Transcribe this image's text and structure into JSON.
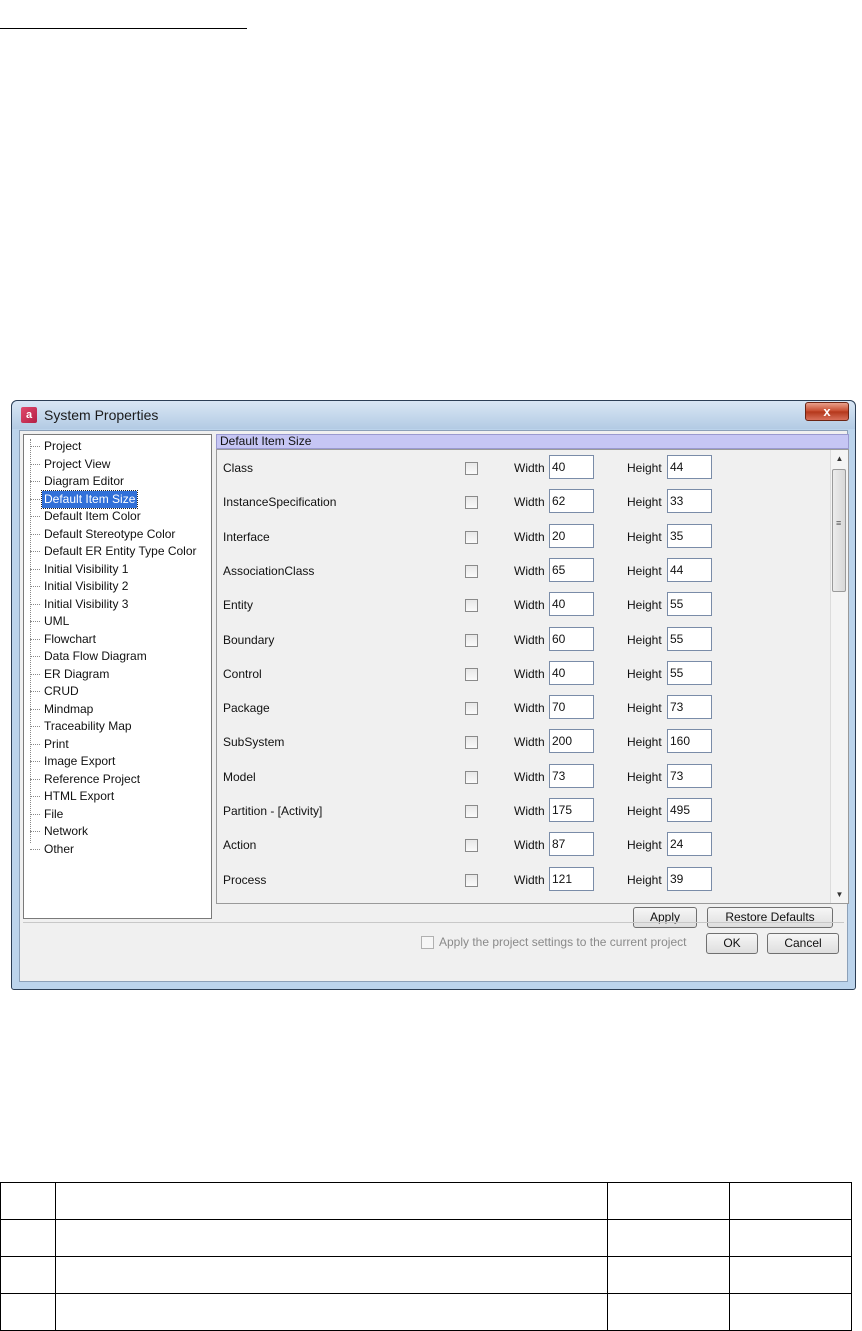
{
  "window": {
    "title": "System Properties",
    "app_icon_label": "a",
    "close_glyph": "x"
  },
  "tree": {
    "items": [
      "Project",
      "Project View",
      "Diagram Editor",
      "Default Item Size",
      "Default Item Color",
      "Default Stereotype Color",
      "Default ER Entity Type Color",
      "Initial Visibility 1",
      "Initial Visibility 2",
      "Initial Visibility 3",
      "UML",
      "Flowchart",
      "Data Flow Diagram",
      "ER Diagram",
      "CRUD",
      "Mindmap",
      "Traceability Map",
      "Print",
      "Image Export",
      "Reference Project",
      "HTML Export",
      "File",
      "Network",
      "Other"
    ],
    "selected": "Default Item Size"
  },
  "panel": {
    "header": "Default Item Size",
    "width_label": "Width",
    "height_label": "Height",
    "rows": [
      {
        "name": "Class",
        "width": "40",
        "height": "44"
      },
      {
        "name": "InstanceSpecification",
        "width": "62",
        "height": "33"
      },
      {
        "name": "Interface",
        "width": "20",
        "height": "35"
      },
      {
        "name": "AssociationClass",
        "width": "65",
        "height": "44"
      },
      {
        "name": "Entity",
        "width": "40",
        "height": "55"
      },
      {
        "name": "Boundary",
        "width": "60",
        "height": "55"
      },
      {
        "name": "Control",
        "width": "40",
        "height": "55"
      },
      {
        "name": "Package",
        "width": "70",
        "height": "73"
      },
      {
        "name": "SubSystem",
        "width": "200",
        "height": "160"
      },
      {
        "name": "Model",
        "width": "73",
        "height": "73"
      },
      {
        "name": "Partition - [Activity]",
        "width": "175",
        "height": "495"
      },
      {
        "name": "Action",
        "width": "87",
        "height": "24"
      },
      {
        "name": "Process",
        "width": "121",
        "height": "39"
      }
    ]
  },
  "buttons": {
    "apply": "Apply",
    "restore_defaults": "Restore Defaults",
    "ok": "OK",
    "cancel": "Cancel"
  },
  "apply_project_label": "Apply the project settings to the current project",
  "colors": {
    "selection": "#3170d8",
    "panel_header": "#c6c6f4",
    "close_button": "#c5472a"
  }
}
